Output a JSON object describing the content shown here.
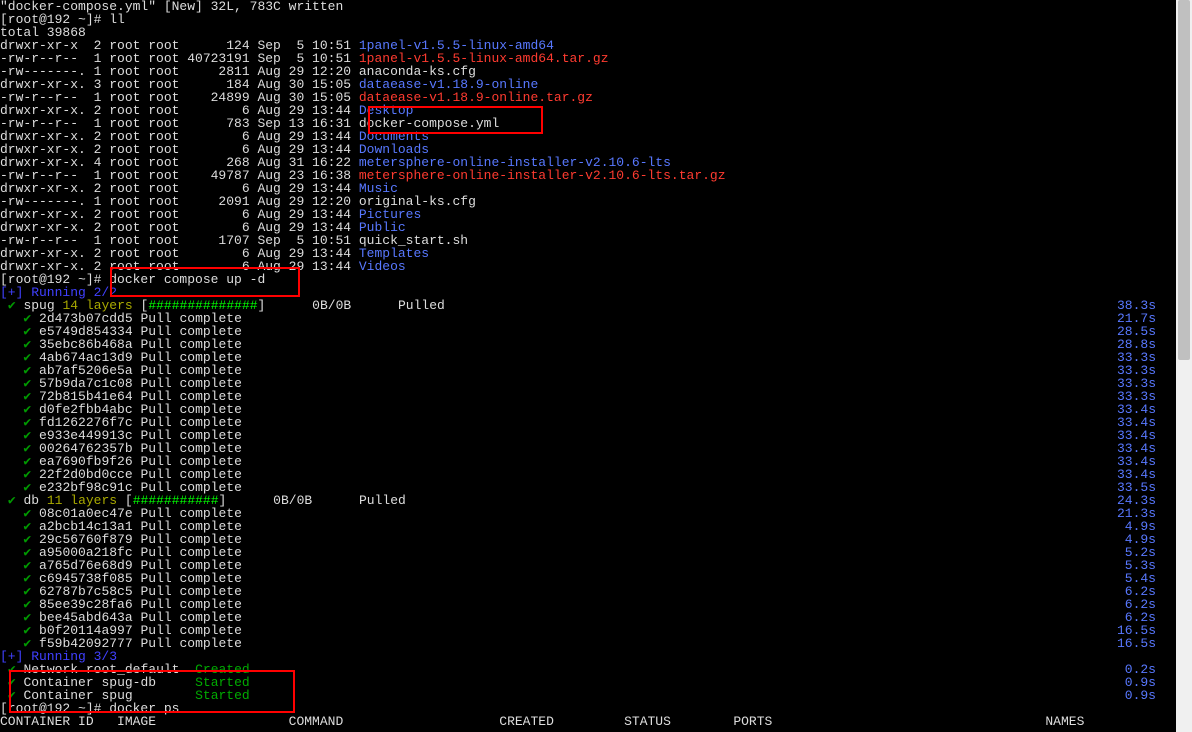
{
  "header_line": "\"docker-compose.yml\" [New] 32L, 783C written",
  "prompt1": "[root@192 ~]# ",
  "cmd1": "ll",
  "total_line": "total 39868",
  "ls": [
    {
      "perm": "drwxr-xr-x",
      "n": "2",
      "owner": "root root",
      "size": "124",
      "date": "Sep  5 10:51",
      "name": "1panel-v1.5.5-linux-amd64",
      "cls": "blue"
    },
    {
      "perm": "-rw-r--r--",
      "n": "1",
      "owner": "root root",
      "size": "40723191",
      "date": "Sep  5 10:51",
      "name": "1panel-v1.5.5-linux-amd64.tar.gz",
      "cls": "red"
    },
    {
      "perm": "-rw-------.",
      "n": "1",
      "owner": "root root",
      "size": "2811",
      "date": "Aug 29 12:20",
      "name": "anaconda-ks.cfg",
      "cls": "white"
    },
    {
      "perm": "drwxr-xr-x.",
      "n": "3",
      "owner": "root root",
      "size": "184",
      "date": "Aug 30 15:05",
      "name": "dataease-v1.18.9-online",
      "cls": "blue"
    },
    {
      "perm": "-rw-r--r--",
      "n": "1",
      "owner": "root root",
      "size": "24899",
      "date": "Aug 30 15:05",
      "name": "dataease-v1.18.9-online.tar.gz",
      "cls": "red"
    },
    {
      "perm": "drwxr-xr-x.",
      "n": "2",
      "owner": "root root",
      "size": "6",
      "date": "Aug 29 13:44",
      "name": "Desktop",
      "cls": "blue",
      "struck": true
    },
    {
      "perm": "-rw-r--r--",
      "n": "1",
      "owner": "root root",
      "size": "783",
      "date": "Sep 13 16:31",
      "name": "docker-compose.yml",
      "cls": "white",
      "boxed": true
    },
    {
      "perm": "drwxr-xr-x.",
      "n": "2",
      "owner": "root root",
      "size": "6",
      "date": "Aug 29 13:44",
      "name": "Documents",
      "cls": "blue",
      "struck": true
    },
    {
      "perm": "drwxr-xr-x.",
      "n": "2",
      "owner": "root root",
      "size": "6",
      "date": "Aug 29 13:44",
      "name": "Downloads",
      "cls": "blue"
    },
    {
      "perm": "drwxr-xr-x.",
      "n": "4",
      "owner": "root root",
      "size": "268",
      "date": "Aug 31 16:22",
      "name": "metersphere-online-installer-v2.10.6-lts",
      "cls": "blue"
    },
    {
      "perm": "-rw-r--r--",
      "n": "1",
      "owner": "root root",
      "size": "49787",
      "date": "Aug 23 16:38",
      "name": "metersphere-online-installer-v2.10.6-lts.tar.gz",
      "cls": "red"
    },
    {
      "perm": "drwxr-xr-x.",
      "n": "2",
      "owner": "root root",
      "size": "6",
      "date": "Aug 29 13:44",
      "name": "Music",
      "cls": "blue"
    },
    {
      "perm": "-rw-------.",
      "n": "1",
      "owner": "root root",
      "size": "2091",
      "date": "Aug 29 12:20",
      "name": "original-ks.cfg",
      "cls": "white"
    },
    {
      "perm": "drwxr-xr-x.",
      "n": "2",
      "owner": "root root",
      "size": "6",
      "date": "Aug 29 13:44",
      "name": "Pictures",
      "cls": "blue"
    },
    {
      "perm": "drwxr-xr-x.",
      "n": "2",
      "owner": "root root",
      "size": "6",
      "date": "Aug 29 13:44",
      "name": "Public",
      "cls": "blue"
    },
    {
      "perm": "-rw-r--r--",
      "n": "1",
      "owner": "root root",
      "size": "1707",
      "date": "Sep  5 10:51",
      "name": "quick_start.sh",
      "cls": "white"
    },
    {
      "perm": "drwxr-xr-x.",
      "n": "2",
      "owner": "root root",
      "size": "6",
      "date": "Aug 29 13:44",
      "name": "Templates",
      "cls": "blue"
    },
    {
      "perm": "drwxr-xr-x.",
      "n": "2",
      "owner": "root root",
      "size": "6",
      "date": "Aug 29 13:44",
      "name": "Videos",
      "cls": "blue"
    }
  ],
  "prompt2": "[root@192 ~]# ",
  "cmd2": "docker compose up -d",
  "running_header": "[+] Running 2/2",
  "spug_line": {
    "name": "spug",
    "layers": "14 layers",
    "bytes": "0B/0B",
    "status": "Pulled",
    "time": "38.3s",
    "hashes": "##############"
  },
  "spug_layers": [
    {
      "hash": "2d473b07cdd5",
      "status": "Pull complete",
      "time": "21.7s"
    },
    {
      "hash": "e5749d854334",
      "status": "Pull complete",
      "time": "28.5s"
    },
    {
      "hash": "35ebc86b468a",
      "status": "Pull complete",
      "time": "28.8s"
    },
    {
      "hash": "4ab674ac13d9",
      "status": "Pull complete",
      "time": "33.3s"
    },
    {
      "hash": "ab7af5206e5a",
      "status": "Pull complete",
      "time": "33.3s"
    },
    {
      "hash": "57b9da7c1c08",
      "status": "Pull complete",
      "time": "33.3s"
    },
    {
      "hash": "72b815b41e64",
      "status": "Pull complete",
      "time": "33.3s"
    },
    {
      "hash": "d0fe2fbb4abc",
      "status": "Pull complete",
      "time": "33.4s"
    },
    {
      "hash": "fd1262276f7c",
      "status": "Pull complete",
      "time": "33.4s"
    },
    {
      "hash": "e933e449913c",
      "status": "Pull complete",
      "time": "33.4s"
    },
    {
      "hash": "00264762357b",
      "status": "Pull complete",
      "time": "33.4s"
    },
    {
      "hash": "ea7690fb9f26",
      "status": "Pull complete",
      "time": "33.4s"
    },
    {
      "hash": "22f2d0bd0cce",
      "status": "Pull complete",
      "time": "33.4s"
    },
    {
      "hash": "e232bf98c91c",
      "status": "Pull complete",
      "time": "33.5s"
    }
  ],
  "db_line": {
    "name": "db",
    "layers": "11 layers",
    "bytes": "0B/0B",
    "status": "Pulled",
    "time": "24.3s",
    "hashes": "###########"
  },
  "db_layers": [
    {
      "hash": "08c01a0ec47e",
      "status": "Pull complete",
      "time": "21.3s"
    },
    {
      "hash": "a2bcb14c13a1",
      "status": "Pull complete",
      "time": "4.9s"
    },
    {
      "hash": "29c56760f879",
      "status": "Pull complete",
      "time": "4.9s"
    },
    {
      "hash": "a95000a218fc",
      "status": "Pull complete",
      "time": "5.2s"
    },
    {
      "hash": "a765d76e68d9",
      "status": "Pull complete",
      "time": "5.3s"
    },
    {
      "hash": "c6945738f085",
      "status": "Pull complete",
      "time": "5.4s"
    },
    {
      "hash": "62787b7c58c5",
      "status": "Pull complete",
      "time": "6.2s"
    },
    {
      "hash": "85ee39c28fa6",
      "status": "Pull complete",
      "time": "6.2s"
    },
    {
      "hash": "bee45abd643a",
      "status": "Pull complete",
      "time": "6.2s"
    },
    {
      "hash": "b0f20114a997",
      "status": "Pull complete",
      "time": "16.5s"
    },
    {
      "hash": "f59b42092777",
      "status": "Pull complete",
      "time": "16.5s"
    }
  ],
  "running_header2": "[+] Running 3/3",
  "containers": [
    {
      "name": "Network root_default",
      "status": "Created",
      "time": "0.2s"
    },
    {
      "name": "Container spug-db",
      "status": "Started",
      "time": "0.9s"
    },
    {
      "name": "Container spug",
      "status": "Started",
      "time": "0.9s"
    }
  ],
  "prompt3": "[root@192 ~]# ",
  "cmd3": "docker ps",
  "ps_header": {
    "c1": "CONTAINER ID",
    "c2": "IMAGE",
    "c3": "COMMAND",
    "c4": "CREATED",
    "c5": "STATUS",
    "c6": "PORTS",
    "c7": "NAMES"
  }
}
